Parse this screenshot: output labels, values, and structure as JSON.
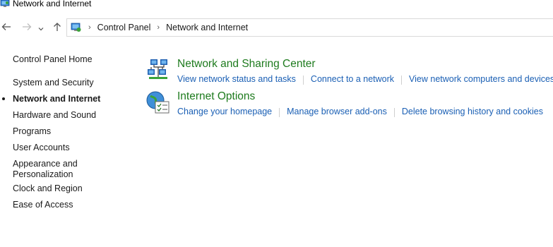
{
  "window": {
    "title": "Network and Internet"
  },
  "navbar": {
    "breadcrumb": [
      "Control Panel",
      "Network and Internet"
    ]
  },
  "leftnav": {
    "items": [
      {
        "label": "Control Panel Home"
      },
      {
        "label": "System and Security"
      },
      {
        "label": "Network and Internet",
        "current": true
      },
      {
        "label": "Hardware and Sound"
      },
      {
        "label": "Programs"
      },
      {
        "label": "User Accounts"
      },
      {
        "label": "Appearance and Personalization"
      },
      {
        "label": "Clock and Region"
      },
      {
        "label": "Ease of Access"
      }
    ]
  },
  "categories": [
    {
      "title": "Network and Sharing Center",
      "icon": "network-sharing-icon",
      "links": [
        "View network status and tasks",
        "Connect to a network",
        "View network computers and devices"
      ]
    },
    {
      "title": "Internet Options",
      "icon": "internet-options-icon",
      "links": [
        "Change your homepage",
        "Manage browser add-ons",
        "Delete browsing history and cookies"
      ]
    }
  ],
  "colors": {
    "category_title": "#1e7b1e",
    "link": "#1a5fb4"
  }
}
